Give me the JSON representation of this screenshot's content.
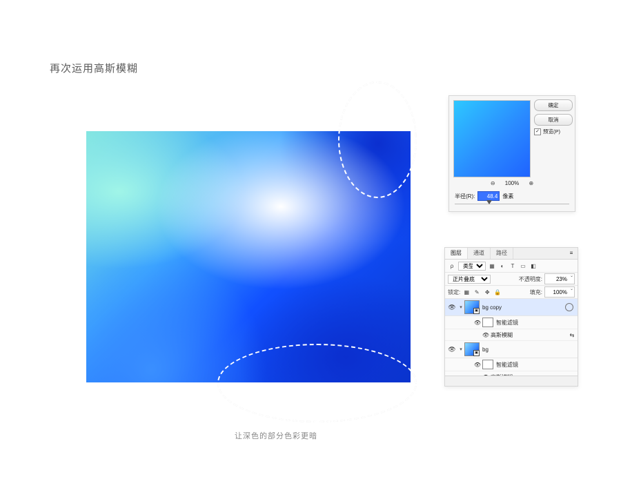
{
  "title": "再次运用高斯模糊",
  "caption": "让深色的部分色彩更暗",
  "blur_dialog": {
    "ok": "确定",
    "cancel": "取消",
    "preview_label": "预览(P)",
    "zoom": "100%",
    "radius_label": "半径(R):",
    "radius_value": "48.4",
    "radius_unit": "像素"
  },
  "layers_panel": {
    "tabs": {
      "layers": "图层",
      "channels": "通道",
      "paths": "路径"
    },
    "kind_label": "类型",
    "blend_mode": "正片叠底",
    "opacity_label": "不透明度:",
    "opacity_value": "23%",
    "lock_label": "锁定:",
    "fill_label": "填充:",
    "fill_value": "100%",
    "layers": [
      {
        "name": "bg copy"
      },
      {
        "name": "bg"
      }
    ],
    "smart_filters_label": "智能滤镜",
    "gaussian_label": "高斯模糊"
  }
}
